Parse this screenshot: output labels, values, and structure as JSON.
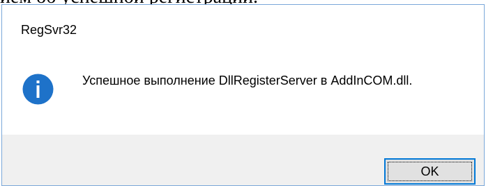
{
  "background_document": {
    "visible_text": "ием об успешной регистрации."
  },
  "dialog": {
    "title": "RegSvr32",
    "icon": "info-icon",
    "message": "Успешное выполнение DllRegisterServer в AddInCOM.dll.",
    "ok_label": "OK"
  },
  "colors": {
    "icon_blue": "#1e72c9",
    "accent_border": "#0078d7",
    "footer_bg": "#f0f0f0",
    "window_border": "#7aa7d9"
  }
}
